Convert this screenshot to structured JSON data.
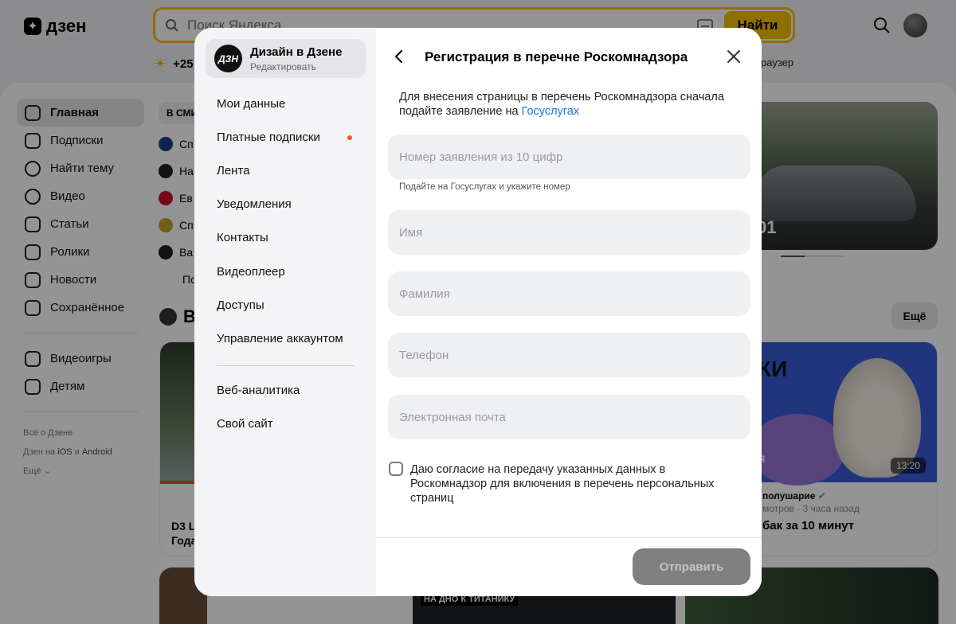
{
  "header": {
    "logo_text": "дзен",
    "search_placeholder": "Поиск Яндекса",
    "search_button": "Найти",
    "weather": "+25",
    "browser_link": "раузер"
  },
  "sidebar": {
    "items": [
      {
        "label": "Главная"
      },
      {
        "label": "Подписки"
      },
      {
        "label": "Найти тему"
      },
      {
        "label": "Видео"
      },
      {
        "label": "Статьи"
      },
      {
        "label": "Ролики"
      },
      {
        "label": "Новости"
      },
      {
        "label": "Сохранённое"
      },
      {
        "label": "Видеоигры"
      },
      {
        "label": "Детям"
      }
    ],
    "footer": {
      "about": "Всё о Дзене",
      "apps_prefix": "Дзен на",
      "ios": "iOS",
      "and": "и",
      "android": "Android",
      "more": "Ещё"
    }
  },
  "media": {
    "tab": "В СМИ",
    "rows": [
      "Сп",
      "На",
      "Ев",
      "Сп",
      "Ва",
      "По"
    ]
  },
  "feed": {
    "video_heading": "В",
    "more_button": "Ещё",
    "car_number": "01",
    "left_card_title_1": "D3 L",
    "left_card_title_2": "Года",
    "right_card": {
      "overlay_text": "КИ",
      "badge_text": "ЯЯ",
      "duration": "13:20",
      "channel": "полушарие",
      "meta": "мотров · 3 часа назад",
      "title": "бак за 10 минут"
    },
    "bottom_card_text": "НА ДНО К ТИТАНИКУ"
  },
  "modal": {
    "channel_name": "Дизайн в Дзене",
    "channel_sub": "Редактировать",
    "channel_avatar_text": "ДЗН",
    "menu": [
      {
        "label": "Мои данные"
      },
      {
        "label": "Платные подписки",
        "badge": true
      },
      {
        "label": "Лента"
      },
      {
        "label": "Уведомления"
      },
      {
        "label": "Контакты"
      },
      {
        "label": "Видеоплеер"
      },
      {
        "label": "Доступы"
      },
      {
        "label": "Управление аккаунтом"
      }
    ],
    "menu_extra": [
      {
        "label": "Веб-аналитика"
      },
      {
        "label": "Свой сайт"
      }
    ],
    "title": "Регистрация в перечне Роскомнадзора",
    "description": "Для внесения страницы в перечень Роскомнадзора сначала подайте заявление на",
    "description_link": "Госуслугах",
    "fields": {
      "application_placeholder": "Номер заявления из 10 цифр",
      "application_hint": "Подайте на Госуслугах и укажите номер",
      "first_name_placeholder": "Имя",
      "last_name_placeholder": "Фамилия",
      "phone_placeholder": "Телефон",
      "email_placeholder": "Электронная почта"
    },
    "consent": "Даю согласие на передачу указанных данных в Роскомнадзор для включения в перечень персональных страниц",
    "submit": "Отправить"
  }
}
